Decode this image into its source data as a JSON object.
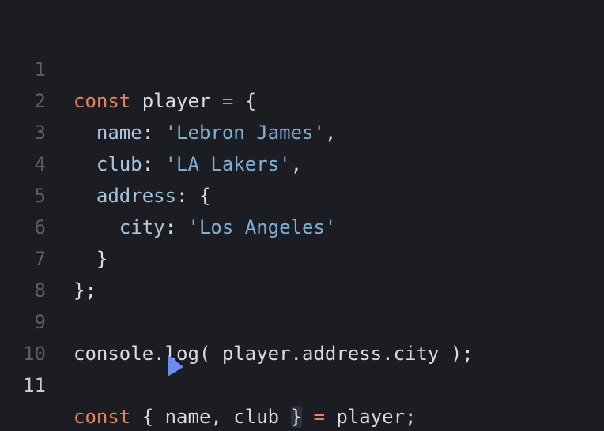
{
  "editor": {
    "lines": [
      {
        "number": "1",
        "parts": [
          "const",
          " player ",
          "=",
          " {"
        ]
      },
      {
        "number": "2",
        "parts": [
          "  ",
          "name",
          ": ",
          "'Lebron James'",
          ","
        ]
      },
      {
        "number": "3",
        "parts": [
          "  ",
          "club",
          ": ",
          "'LA Lakers'",
          ","
        ]
      },
      {
        "number": "4",
        "parts": [
          "  ",
          "address",
          ": {"
        ]
      },
      {
        "number": "5",
        "parts": [
          "    ",
          "city",
          ": ",
          "'Los Angeles'"
        ]
      },
      {
        "number": "6",
        "parts": [
          "  }"
        ]
      },
      {
        "number": "7",
        "parts": [
          "};"
        ]
      },
      {
        "number": "8",
        "parts": [
          ""
        ]
      },
      {
        "number": "9",
        "parts": [
          "console.log( player.address.city );"
        ]
      },
      {
        "number": "10",
        "parts": [
          ""
        ]
      },
      {
        "number": "11",
        "parts": [
          "const",
          " { name, club ",
          "}",
          " ",
          "=",
          " player;"
        ]
      }
    ],
    "current_line": "11"
  },
  "colors": {
    "background": "#1b1d23",
    "keyword": "#e8835f",
    "property": "#a9c6dc",
    "string": "#7eb0d6",
    "text": "#dcdcdc",
    "line_number": "#5a5f6b",
    "cursor": "#6d8cf0"
  },
  "icons": {
    "cursor": "mouse-pointer-icon"
  }
}
